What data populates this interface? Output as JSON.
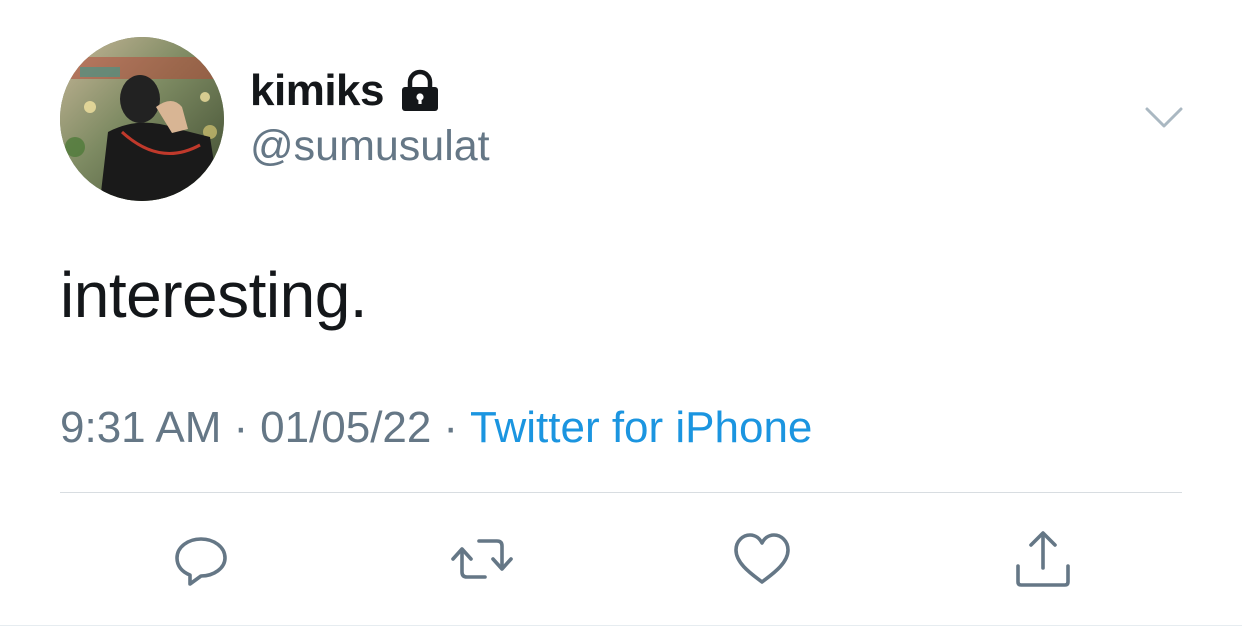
{
  "author": {
    "display_name": "kimiks",
    "handle": "@sumusulat",
    "protected_icon": "lock-icon",
    "avatar": "avatar-photo"
  },
  "tweet": {
    "text": "interesting.",
    "time": "9:31 AM",
    "separator": "·",
    "date": "01/05/22",
    "source": "Twitter for iPhone"
  },
  "menu_icon": "chevron-down-icon",
  "actions": [
    "reply-icon",
    "retweet-icon",
    "like-icon",
    "share-icon"
  ],
  "colors": {
    "text_primary": "#14171a",
    "text_secondary": "#657786",
    "link": "#1b95e0",
    "icon": "#657786",
    "divider": "#d8dde1"
  }
}
